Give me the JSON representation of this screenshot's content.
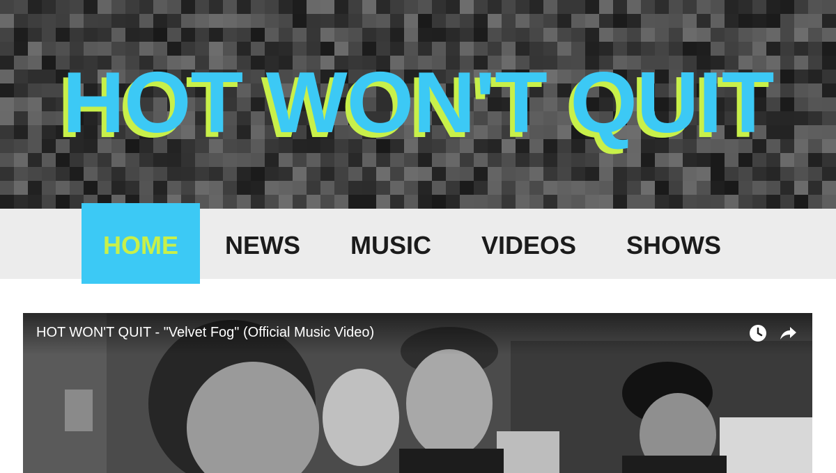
{
  "header": {
    "site_title": "HOT WON'T QUIT"
  },
  "nav": {
    "items": [
      {
        "label": "HOME",
        "active": true
      },
      {
        "label": "NEWS",
        "active": false
      },
      {
        "label": "MUSIC",
        "active": false
      },
      {
        "label": "VIDEOS",
        "active": false
      },
      {
        "label": "SHOWS",
        "active": false
      }
    ]
  },
  "video": {
    "title": "HOT WON'T QUIT - \"Velvet Fog\" (Official Music Video)",
    "controls": [
      "watch-later-icon",
      "share-icon"
    ]
  },
  "colors": {
    "accent_blue": "#3cc9f5",
    "accent_lime": "#c8f04a",
    "nav_bg": "#ececec",
    "nav_text": "#1b1b1b"
  }
}
